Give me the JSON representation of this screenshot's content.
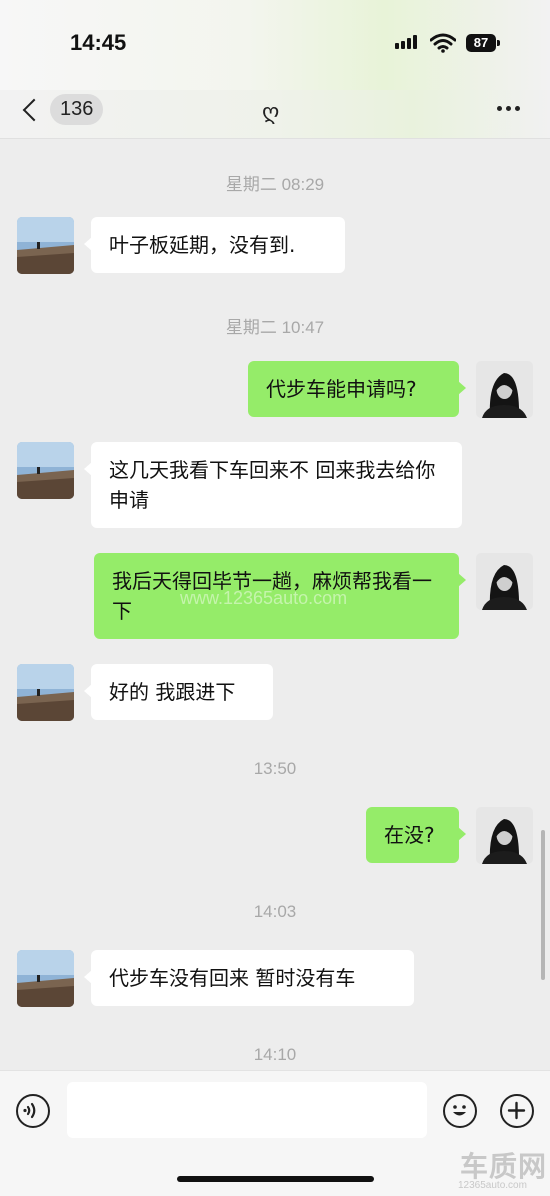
{
  "status_bar": {
    "time": "14:45",
    "battery": "87"
  },
  "nav": {
    "back_count": "136",
    "title": "ღ"
  },
  "messages": [
    {
      "type": "time",
      "text": "星期二 08:29"
    },
    {
      "type": "in",
      "text": "叶子板延期，没有到."
    },
    {
      "type": "time",
      "text": "星期二 10:47"
    },
    {
      "type": "out",
      "text": "代步车能申请吗?"
    },
    {
      "type": "in",
      "text": "这几天我看下车回来不 回来我去给你申请"
    },
    {
      "type": "out",
      "text": "我后天得回毕节一趟，麻烦帮我看一下"
    },
    {
      "type": "in",
      "text": "好的 我跟进下"
    },
    {
      "type": "time",
      "text": "13:50"
    },
    {
      "type": "out",
      "text": "在没?"
    },
    {
      "type": "time",
      "text": "14:03"
    },
    {
      "type": "in",
      "text": "代步车没有回来 暂时没有车"
    },
    {
      "type": "time",
      "text": "14:10"
    }
  ],
  "watermark": {
    "center": "www.12365auto.com",
    "logo": "车质网",
    "url": "12365auto.com"
  },
  "input": {
    "placeholder": ""
  },
  "colors": {
    "incoming_bubble": "#ffffff",
    "outgoing_bubble": "#95ec69",
    "background": "#ededed"
  },
  "icons": {
    "voice": "voice-icon",
    "emoji": "emoji-icon",
    "plus": "plus-icon",
    "more": "more-icon",
    "back": "back-icon"
  }
}
